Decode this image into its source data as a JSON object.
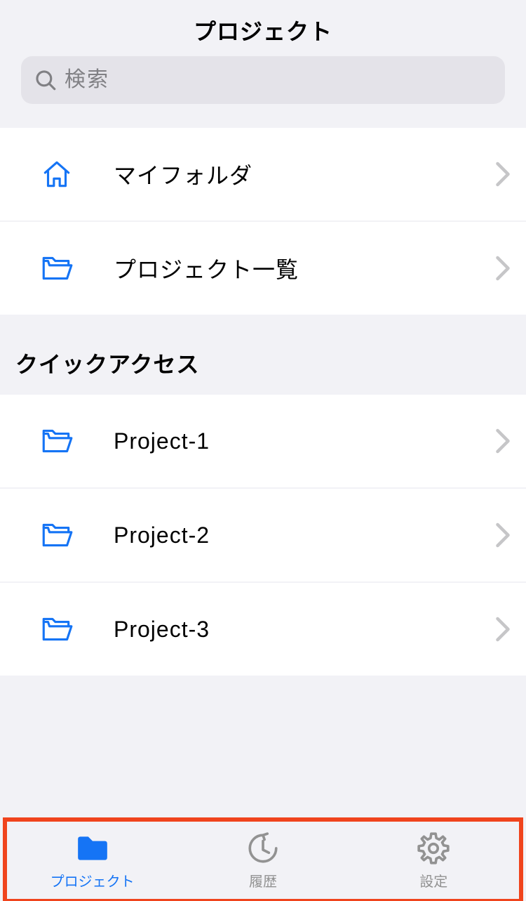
{
  "header": {
    "title": "プロジェクト"
  },
  "search": {
    "placeholder": "検索"
  },
  "nav": {
    "items": [
      {
        "label": "マイフォルダ",
        "icon": "home"
      },
      {
        "label": "プロジェクト一覧",
        "icon": "folder"
      }
    ]
  },
  "quick_access": {
    "heading": "クイックアクセス",
    "items": [
      {
        "label": "Project-1"
      },
      {
        "label": "Project-2"
      },
      {
        "label": "Project-3"
      }
    ]
  },
  "tabbar": {
    "items": [
      {
        "label": "プロジェクト",
        "icon": "folder-solid",
        "active": true
      },
      {
        "label": "履歴",
        "icon": "history",
        "active": false
      },
      {
        "label": "設定",
        "icon": "gear",
        "active": false
      }
    ]
  },
  "colors": {
    "accent": "#1574f5",
    "highlight_border": "#f0441d",
    "inactive": "#929292"
  }
}
